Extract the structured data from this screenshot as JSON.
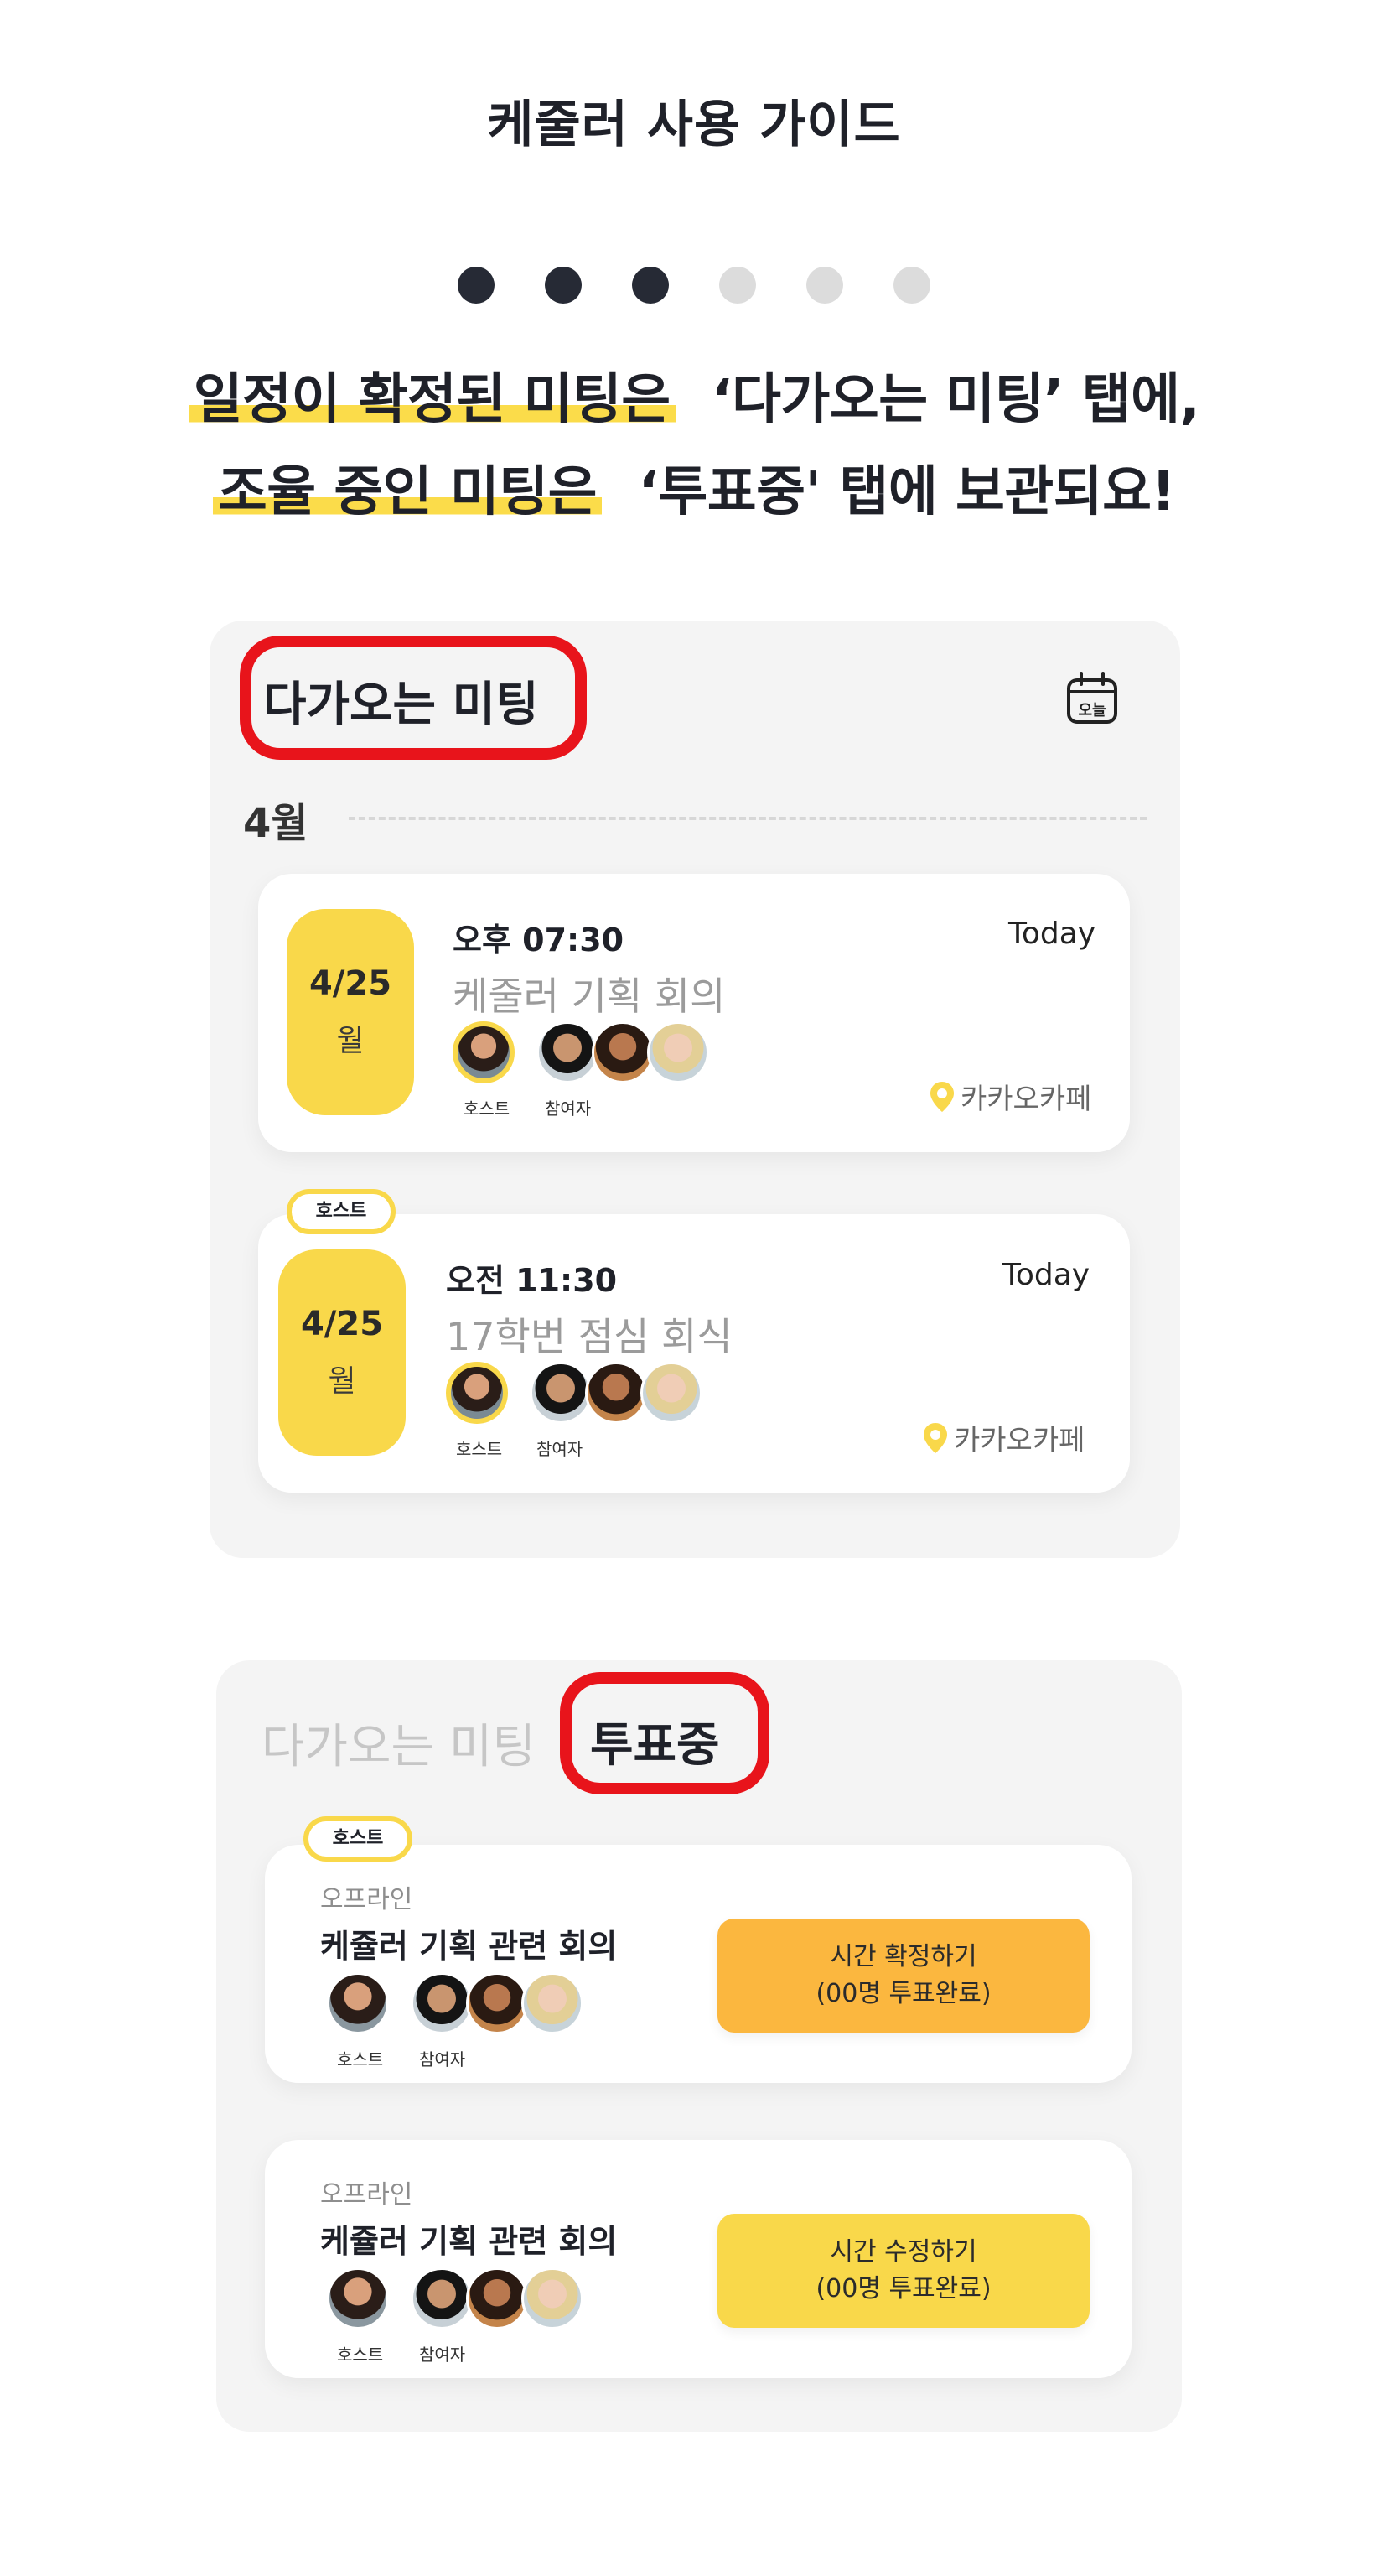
{
  "page": {
    "title": "케줄러 사용 가이드"
  },
  "pager": {
    "total": 6,
    "active": 3
  },
  "headline": {
    "line1_highlight": "일정이 확정된 미팅은",
    "line1_rest": "‘다가오는 미팅’ 탭에,",
    "line2_highlight": "조율 중인 미팅은",
    "line2_rest": "‘투표중' 탭에 보관되요!"
  },
  "upcoming": {
    "header": "다가오는 미팅",
    "today_icon_label": "오늘",
    "month": "4월",
    "meetings": [
      {
        "date": "4/25",
        "weekday": "월",
        "time": "오후 07:30",
        "badge": "Today",
        "title": "케줄러 기획 회의",
        "host_label": "호스트",
        "participant_label": "참여자",
        "location": "카카오카페",
        "is_host": false
      },
      {
        "date": "4/25",
        "weekday": "월",
        "time": "오전 11:30",
        "badge": "Today",
        "title": "17학번 점심 회식",
        "host_label": "호스트",
        "participant_label": "참여자",
        "location": "카카오카페",
        "is_host": true,
        "host_badge": "호스트"
      }
    ]
  },
  "voting": {
    "tab_inactive": "다가오는 미팅",
    "tab_active": "투표중",
    "items": [
      {
        "host_badge": "호스트",
        "type": "오프라인",
        "title": "케쥴러 기획 관련 회의",
        "host_label": "호스트",
        "participant_label": "참여자",
        "button_line1": "시간 확정하기",
        "button_line2": "(00명 투표완료)"
      },
      {
        "type": "오프라인",
        "title": "케쥴러 기획 관련 회의",
        "host_label": "호스트",
        "participant_label": "참여자",
        "button_line1": "시간 수정하기",
        "button_line2": "(00명 투표완료)"
      }
    ]
  },
  "colors": {
    "accent_yellow": "#f9d84a",
    "accent_orange": "#fbb73f",
    "highlight_red": "#e8141b",
    "dot_active": "#262a35",
    "dot_inactive": "#dcdcdc"
  },
  "icons": [
    "calendar-today-icon",
    "location-pin-icon"
  ]
}
